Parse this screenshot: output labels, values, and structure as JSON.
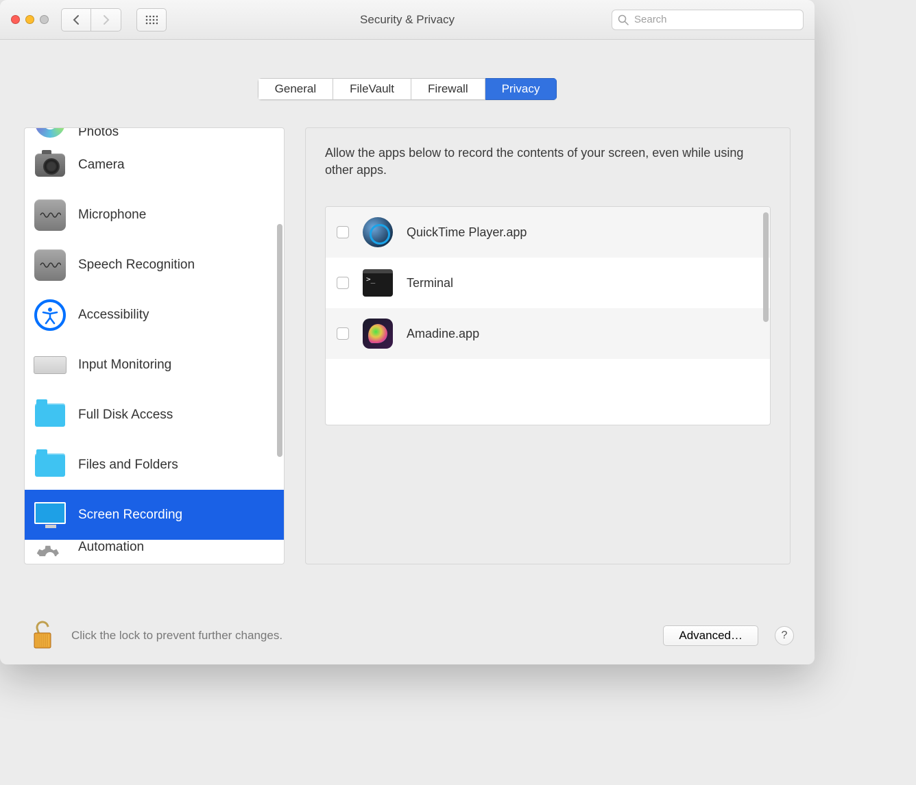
{
  "window": {
    "title": "Security & Privacy"
  },
  "search": {
    "placeholder": "Search"
  },
  "tabs": [
    {
      "label": "General",
      "active": false
    },
    {
      "label": "FileVault",
      "active": false
    },
    {
      "label": "Firewall",
      "active": false
    },
    {
      "label": "Privacy",
      "active": true
    }
  ],
  "sidebar": {
    "items": [
      {
        "label": "Photos",
        "icon": "photos-icon"
      },
      {
        "label": "Camera",
        "icon": "camera-icon"
      },
      {
        "label": "Microphone",
        "icon": "microphone-icon"
      },
      {
        "label": "Speech Recognition",
        "icon": "speech-icon"
      },
      {
        "label": "Accessibility",
        "icon": "accessibility-icon"
      },
      {
        "label": "Input Monitoring",
        "icon": "keyboard-icon"
      },
      {
        "label": "Full Disk Access",
        "icon": "folder-icon"
      },
      {
        "label": "Files and Folders",
        "icon": "folder-icon"
      },
      {
        "label": "Screen Recording",
        "icon": "screen-icon",
        "selected": true
      },
      {
        "label": "Automation",
        "icon": "gear-icon"
      }
    ]
  },
  "detail": {
    "description": "Allow the apps below to record the contents of your screen, even while using other apps.",
    "apps": [
      {
        "label": "QuickTime Player.app",
        "checked": false,
        "icon": "quicktime-icon"
      },
      {
        "label": "Terminal",
        "checked": false,
        "icon": "terminal-icon"
      },
      {
        "label": "Amadine.app",
        "checked": false,
        "icon": "amadine-icon"
      }
    ]
  },
  "footer": {
    "lock_text": "Click the lock to prevent further changes.",
    "advanced_label": "Advanced…",
    "help_label": "?"
  }
}
